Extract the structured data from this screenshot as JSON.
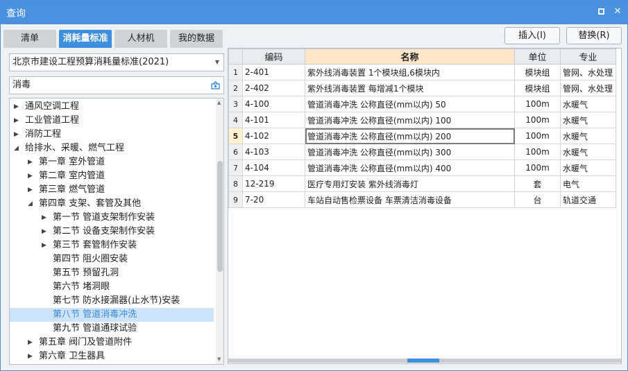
{
  "window": {
    "title": "查询"
  },
  "tabs": [
    {
      "label": "清单",
      "active": false
    },
    {
      "label": "消耗量标准",
      "active": true
    },
    {
      "label": "人材机",
      "active": false
    },
    {
      "label": "我的数据",
      "active": false
    }
  ],
  "buttons": {
    "insert": "插入(I)",
    "replace": "替换(R)"
  },
  "standard_select": {
    "value": "北京市建设工程预算消耗量标准(2021)"
  },
  "search": {
    "value": "消毒"
  },
  "tree": [
    {
      "label": "通风空调工程",
      "level": 0,
      "caret": "right"
    },
    {
      "label": "工业管道工程",
      "level": 0,
      "caret": "right"
    },
    {
      "label": "消防工程",
      "level": 0,
      "caret": "right"
    },
    {
      "label": "给排水、采暖、燃气工程",
      "level": 0,
      "caret": "down"
    },
    {
      "label": "第一章 室外管道",
      "level": 1,
      "caret": "right"
    },
    {
      "label": "第二章 室内管道",
      "level": 1,
      "caret": "right"
    },
    {
      "label": "第三章 燃气管道",
      "level": 1,
      "caret": "right"
    },
    {
      "label": "第四章 支架、套管及其他",
      "level": 1,
      "caret": "down"
    },
    {
      "label": "第一节 管道支架制作安装",
      "level": 2,
      "caret": "right"
    },
    {
      "label": "第二节 设备支架制作安装",
      "level": 2,
      "caret": "right"
    },
    {
      "label": "第三节 套管制作安装",
      "level": 2,
      "caret": "right"
    },
    {
      "label": "第四节 阻火圈安装",
      "level": 2,
      "caret": ""
    },
    {
      "label": "第五节 预留孔洞",
      "level": 2,
      "caret": ""
    },
    {
      "label": "第六节 堵洞眼",
      "level": 2,
      "caret": ""
    },
    {
      "label": "第七节 防水接漏器(止水节)安装",
      "level": 2,
      "caret": ""
    },
    {
      "label": "第八节 管道消毒冲洗",
      "level": 2,
      "caret": "",
      "selected": true
    },
    {
      "label": "第九节 管道通球试验",
      "level": 2,
      "caret": ""
    },
    {
      "label": "第五章 阀门及管道附件",
      "level": 1,
      "caret": "right"
    },
    {
      "label": "第六章 卫生器具",
      "level": 1,
      "caret": "right"
    }
  ],
  "table": {
    "headers": {
      "code": "编码",
      "name": "名称",
      "unit": "单位",
      "specialty": "专业"
    },
    "rows": [
      {
        "idx": "1",
        "code": "2-401",
        "name": "紫外线消毒装置 1个模块组,6模块内",
        "unit": "模块组",
        "specialty": "管网、水处理"
      },
      {
        "idx": "2",
        "code": "2-402",
        "name": "紫外线消毒装置 每增减1个模块",
        "unit": "模块组",
        "specialty": "管网、水处理"
      },
      {
        "idx": "3",
        "code": "4-100",
        "name": "管道消毒冲洗 公称直径(mm以内) 50",
        "unit": "100m",
        "specialty": "水暖气"
      },
      {
        "idx": "4",
        "code": "4-101",
        "name": "管道消毒冲洗 公称直径(mm以内) 100",
        "unit": "100m",
        "specialty": "水暖气"
      },
      {
        "idx": "5",
        "code": "4-102",
        "name": "管道消毒冲洗 公称直径(mm以内) 200",
        "unit": "100m",
        "specialty": "水暖气",
        "current": true
      },
      {
        "idx": "6",
        "code": "4-103",
        "name": "管道消毒冲洗 公称直径(mm以内) 300",
        "unit": "100m",
        "specialty": "水暖气"
      },
      {
        "idx": "7",
        "code": "4-104",
        "name": "管道消毒冲洗 公称直径(mm以内) 400",
        "unit": "100m",
        "specialty": "水暖气"
      },
      {
        "idx": "8",
        "code": "12-219",
        "name": "医疗专用灯安装 紫外线消毒灯",
        "unit": "套",
        "specialty": "电气"
      },
      {
        "idx": "9",
        "code": "7-20",
        "name": "车站自动售检票设备 车票清洁消毒设备",
        "unit": "台",
        "specialty": "轨道交通"
      }
    ]
  },
  "colors": {
    "accent": "#3d8fe0",
    "title_bar": "#4a92e0",
    "selected_tree": "#cde3f7",
    "name_header": "#fde7c8"
  }
}
